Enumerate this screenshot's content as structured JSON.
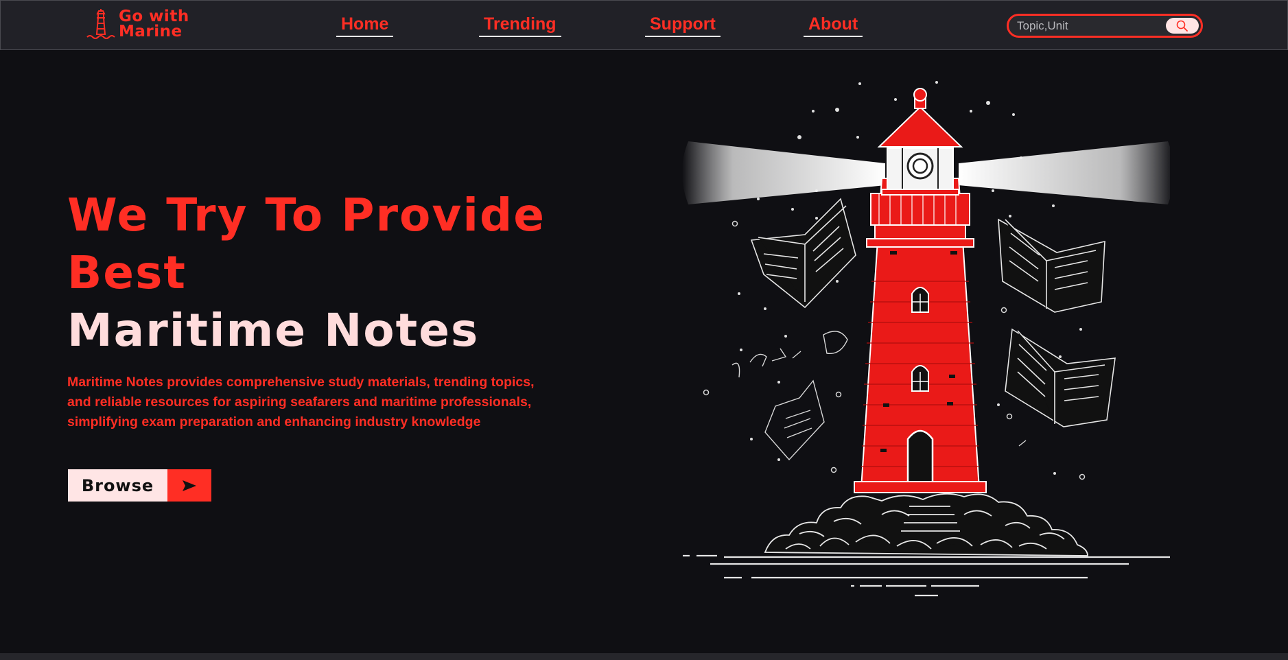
{
  "brand": {
    "line1": "Go with",
    "line2": "Marine",
    "icon": "lighthouse-logo-icon",
    "accent": "#ff2e24"
  },
  "nav": {
    "items": [
      {
        "label": "Home"
      },
      {
        "label": "Trending"
      },
      {
        "label": "Support"
      },
      {
        "label": "About"
      }
    ]
  },
  "search": {
    "placeholder": "Topic,Unit",
    "icon": "search-icon"
  },
  "hero": {
    "title_line1": "We Try To Provide",
    "title_line2": "Best",
    "title_line3": "Maritime Notes",
    "description": "Maritime Notes provides comprehensive study materials, trending topics, and reliable resources for aspiring seafarers and maritime professionals, simplifying exam preparation and enhancing industry knowledge",
    "browse_label": "Browse",
    "browse_icon": "arrow-right-icon"
  },
  "colors": {
    "background": "#0f0f13",
    "navbar": "#212127",
    "accent": "#ff2e24",
    "light": "#ffe5e5"
  }
}
